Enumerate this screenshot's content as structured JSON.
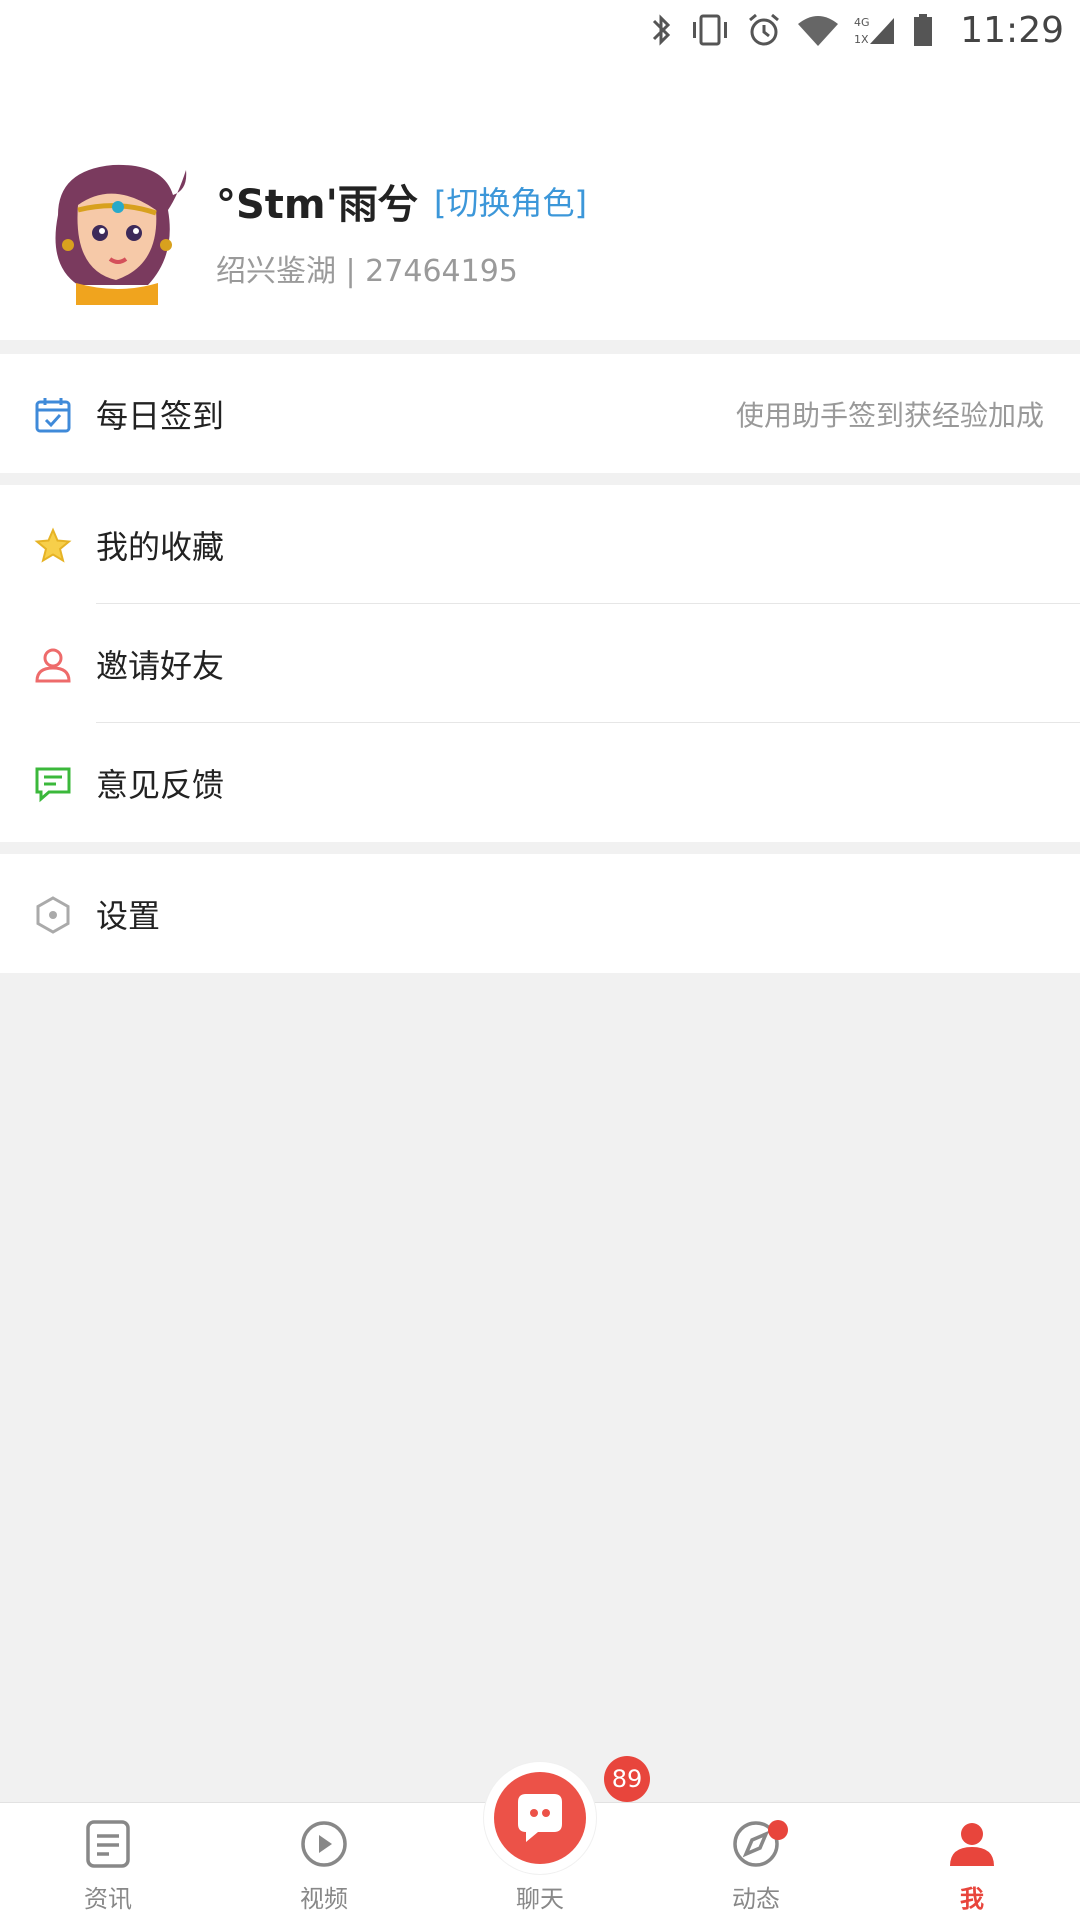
{
  "status_bar": {
    "time": "11:29",
    "icons": [
      "bluetooth-icon",
      "vibrate-icon",
      "alarm-icon",
      "wifi-icon",
      "cellular-4g-icon",
      "battery-icon"
    ],
    "network_label_top": "4G",
    "network_label_bottom": "1X"
  },
  "profile": {
    "username": "°Stm'雨兮",
    "switch_role": "[切换角色]",
    "server_info": "绍兴鉴湖 | 27464195"
  },
  "menu": {
    "checkin": {
      "label": "每日签到",
      "hint": "使用助手签到获经验加成",
      "icon": "calendar-check-icon"
    },
    "favorites": {
      "label": "我的收藏",
      "icon": "star-icon"
    },
    "invite": {
      "label": "邀请好友",
      "icon": "person-icon"
    },
    "feedback": {
      "label": "意见反馈",
      "icon": "message-icon"
    },
    "settings": {
      "label": "设置",
      "icon": "hexagon-settings-icon"
    }
  },
  "tabbar": {
    "tabs": [
      {
        "label": "资讯",
        "icon": "news-icon"
      },
      {
        "label": "视频",
        "icon": "play-icon"
      },
      {
        "label": "聊天",
        "icon": "chat-bubble-icon"
      },
      {
        "label": "动态",
        "icon": "compass-icon"
      },
      {
        "label": "我",
        "icon": "profile-icon"
      }
    ],
    "chat_badge": "89",
    "active_tab": "我"
  },
  "colors": {
    "accent_red": "#e8453c",
    "link_blue": "#3c97d9",
    "page_bg": "#f1f1f1"
  }
}
